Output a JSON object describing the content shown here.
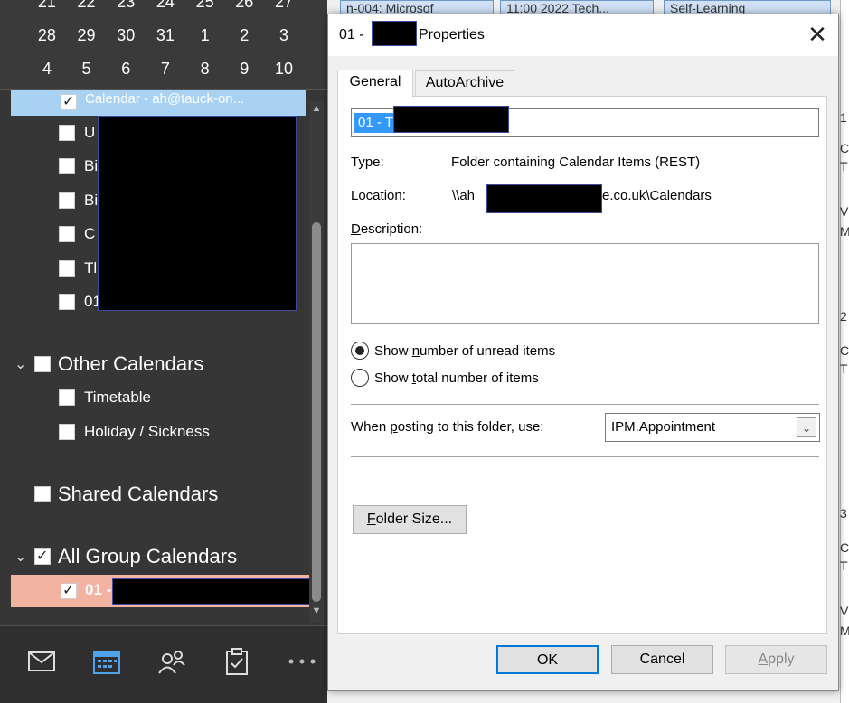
{
  "mini_calendar": {
    "rows": [
      [
        "21",
        "22",
        "23",
        "24",
        "25",
        "26",
        "27"
      ],
      [
        "28",
        "29",
        "30",
        "31",
        "1",
        "2",
        "3"
      ],
      [
        "4",
        "5",
        "6",
        "7",
        "8",
        "9",
        "10"
      ]
    ]
  },
  "folder_pane": {
    "selected_item": "Calendar - ah@tauck-on...",
    "my_calendar_items": [
      "U",
      "Bi",
      "Bi",
      "C",
      "Tl",
      "01"
    ],
    "other_calendars_label": "Other Calendars",
    "other_calendars": [
      "Timetable",
      "Holiday / Sickness"
    ],
    "shared_calendars_label": "Shared Calendars",
    "all_group_calendars_label": "All Group Calendars",
    "group_item": "01 -"
  },
  "calendar_strip": {
    "appointments": [
      "n-004: Microsof",
      "11:00 2022 Tech...",
      "Self-Learning"
    ],
    "edge_marks": [
      "1",
      "C",
      "T",
      "V",
      "M",
      "2",
      "C",
      "T",
      "3",
      "C",
      "T",
      "V",
      "M"
    ]
  },
  "dialog": {
    "title_prefix": "01 -",
    "title_suffix": "Properties",
    "close_glyph": "✕",
    "tabs": [
      "General",
      "AutoArchive"
    ],
    "name_value": "01 - T",
    "type_label": "Type:",
    "type_value": "Folder containing Calendar Items (REST)",
    "location_label": "Location:",
    "location_prefix": "\\\\ah",
    "location_suffix": "e.co.uk\\Calendars",
    "description_label_pre": "",
    "description_label_u": "D",
    "description_label_post": "escription:",
    "radio1_pre": "Show ",
    "radio1_u": "n",
    "radio1_post": "umber of unread items",
    "radio2_pre": "Show ",
    "radio2_u": "t",
    "radio2_post": "otal number of items",
    "posting_pre": "When ",
    "posting_u": "p",
    "posting_post": "osting to this folder, use:",
    "posting_value": "IPM.Appointment",
    "folder_size_u": "F",
    "folder_size_post": "older Size...",
    "ok_label": "OK",
    "cancel_label": "Cancel",
    "apply_u": "A",
    "apply_post": "pply"
  },
  "nav_icons": [
    "mail-icon",
    "calendar-icon",
    "people-icon",
    "tasks-icon",
    "more-icon"
  ],
  "colors": {
    "accent": "#0078d7",
    "selection": "#3399ff",
    "group_highlight": "#f3b3a0",
    "selected_calendar": "#a9d1f2"
  }
}
